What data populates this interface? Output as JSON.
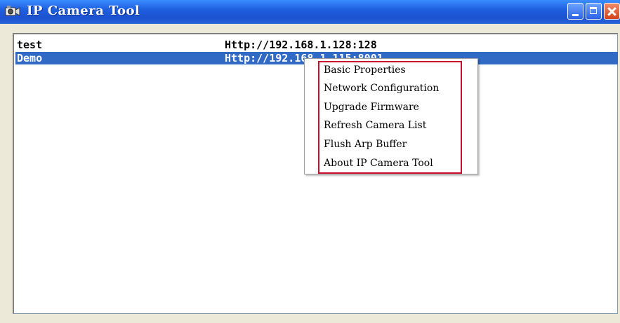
{
  "window": {
    "title": "IP Camera Tool",
    "icon": "camera-app-icon"
  },
  "title_buttons": [
    "minimize-icon",
    "maximize-icon",
    "close-icon"
  ],
  "camera_list": [
    {
      "name": "test",
      "url": "Http://192.168.1.128:128",
      "selected": false
    },
    {
      "name": "Demo",
      "url": "Http://192.168.1.115:8001",
      "selected": true
    }
  ],
  "context_menu": {
    "items": [
      "Basic Properties",
      "Network Configuration",
      "Upgrade Firmware",
      "Refresh Camera List",
      "Flush Arp Buffer",
      "About IP Camera Tool"
    ]
  },
  "colors": {
    "selection": "#316ac5",
    "highlight_box": "#c8102e",
    "titlebar": "#1f5fe0"
  }
}
